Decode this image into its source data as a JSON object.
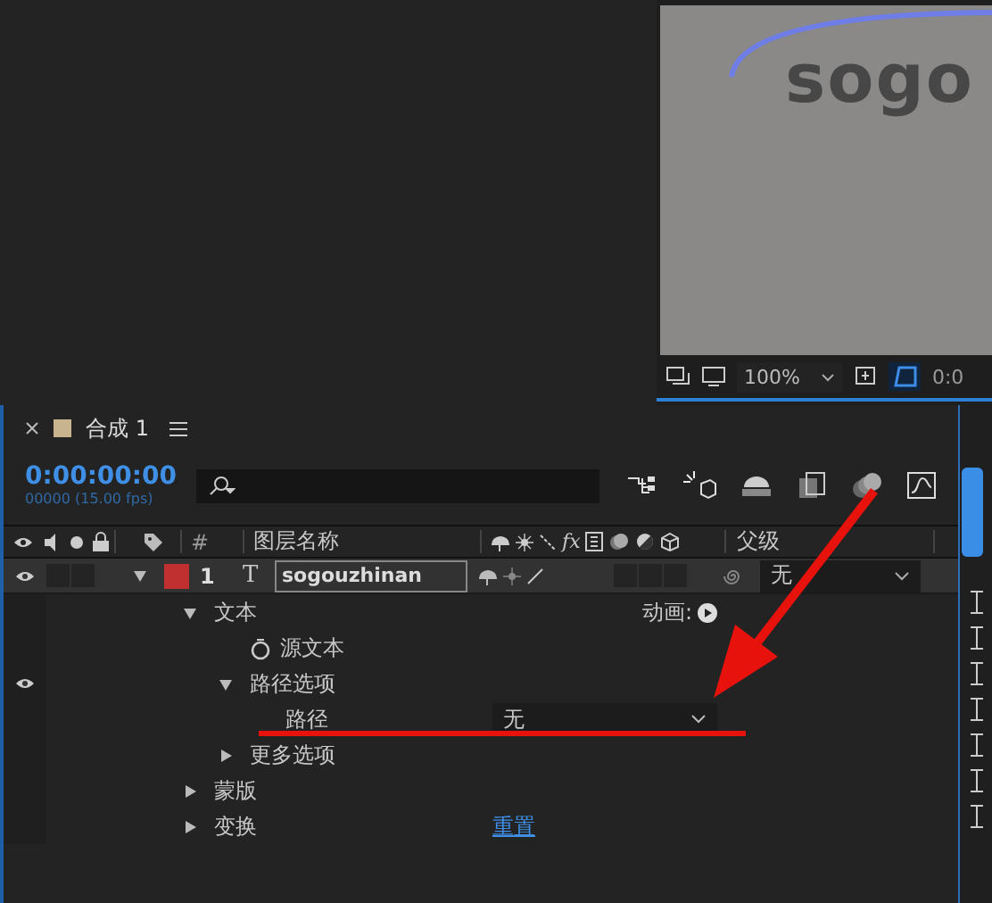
{
  "viewer": {
    "canvas_text": "sogo",
    "zoom": "100%",
    "time": "0:0"
  },
  "panel": {
    "tab_title": "合成 1",
    "timecode": "0:00:00:00",
    "fps": "00000 (15.00 fps)"
  },
  "columns": {
    "number": "#",
    "layer_name": "图层名称",
    "effects": "fx",
    "parent": "父级"
  },
  "layer": {
    "visible": true,
    "expanded": true,
    "number": "1",
    "type_glyph": "T",
    "name": "sogouzhinan",
    "parent": "无"
  },
  "properties": [
    {
      "label": "文本",
      "kind": "group",
      "expanded": true,
      "visible": false,
      "animate": "动画:",
      "children": [
        {
          "label": "源文本",
          "kind": "stopwatch",
          "visible": false
        },
        {
          "label": "路径选项",
          "kind": "group",
          "expanded": true,
          "visible": true,
          "children": [
            {
              "label": "路径",
              "kind": "dropdown",
              "visible": false,
              "value": "无"
            }
          ]
        },
        {
          "label": "更多选项",
          "kind": "group",
          "expanded": false,
          "visible": false
        }
      ]
    },
    {
      "label": "蒙版",
      "kind": "group",
      "expanded": false,
      "visible": false
    },
    {
      "label": "变换",
      "kind": "group",
      "expanded": false,
      "visible": false,
      "link": "重置"
    }
  ]
}
